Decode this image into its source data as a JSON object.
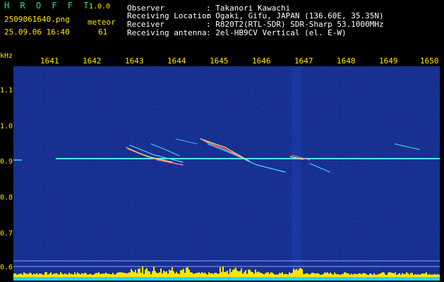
{
  "header": {
    "brand": "H R O F F T",
    "version": "1.0.0",
    "filename": "2509061640.png",
    "meteor_label": "meteor",
    "datetime": "25.09.06 16:40",
    "meteor_count": "61",
    "fields": [
      {
        "label": "Observer",
        "value": ": Takanori Kawachi"
      },
      {
        "label": "Receiving Location",
        "value": ": Ogaki, Gifu, JAPAN (136.60E, 35.35N)"
      },
      {
        "label": "Receiver",
        "value": ": R820T2(RTL-SDR) SDR-Sharp 53.1000MHz"
      },
      {
        "label": "Receiving antenna",
        "value": ": 2el-HB9CV Vertical (el. E-W)"
      }
    ]
  },
  "axes": {
    "unit": "kHz",
    "x_ticks": [
      "1641",
      "1642",
      "1643",
      "1644",
      "1645",
      "1646",
      "1647",
      "1648",
      "1649",
      "1650"
    ],
    "y_ticks": [
      "1.1",
      "1.0",
      "0.9",
      "0.8",
      "0.7",
      "0.6"
    ]
  },
  "colors": {
    "background": "#000080",
    "text_yellow": "#ffe400",
    "brand_green": "#2ee66a",
    "trace_cyan": "#40e0ff"
  }
}
